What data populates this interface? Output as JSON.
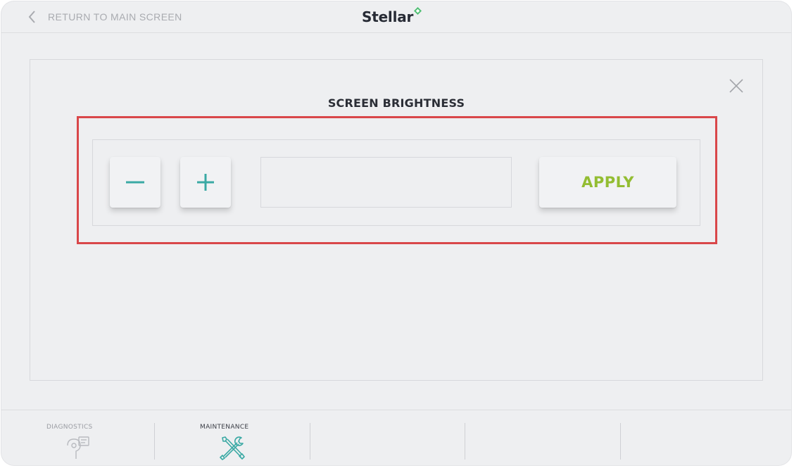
{
  "header": {
    "back_label": "RETURN TO MAIN SCREEN",
    "brand_name": "Stellar",
    "back_icon": "chevron-left-icon",
    "brand_icon": "diamond-logo-icon"
  },
  "dialog": {
    "title": "SCREEN BRIGHTNESS",
    "close_icon": "close-icon",
    "decrease_icon": "minus-icon",
    "increase_icon": "plus-icon",
    "value": "",
    "apply_label": "APPLY"
  },
  "bottom_nav": {
    "items": [
      {
        "label": "DIAGNOSTICS",
        "icon": "diagnostics-icon",
        "active": false
      },
      {
        "label": "MAINTENANCE",
        "icon": "tools-icon",
        "active": true
      }
    ]
  },
  "colors": {
    "screen_bg": "#eeeff1",
    "accent_teal": "#3aa9a4",
    "apply_green": "#93bd32",
    "highlight_red": "#d9474a",
    "brand_green": "#4fbf73"
  }
}
